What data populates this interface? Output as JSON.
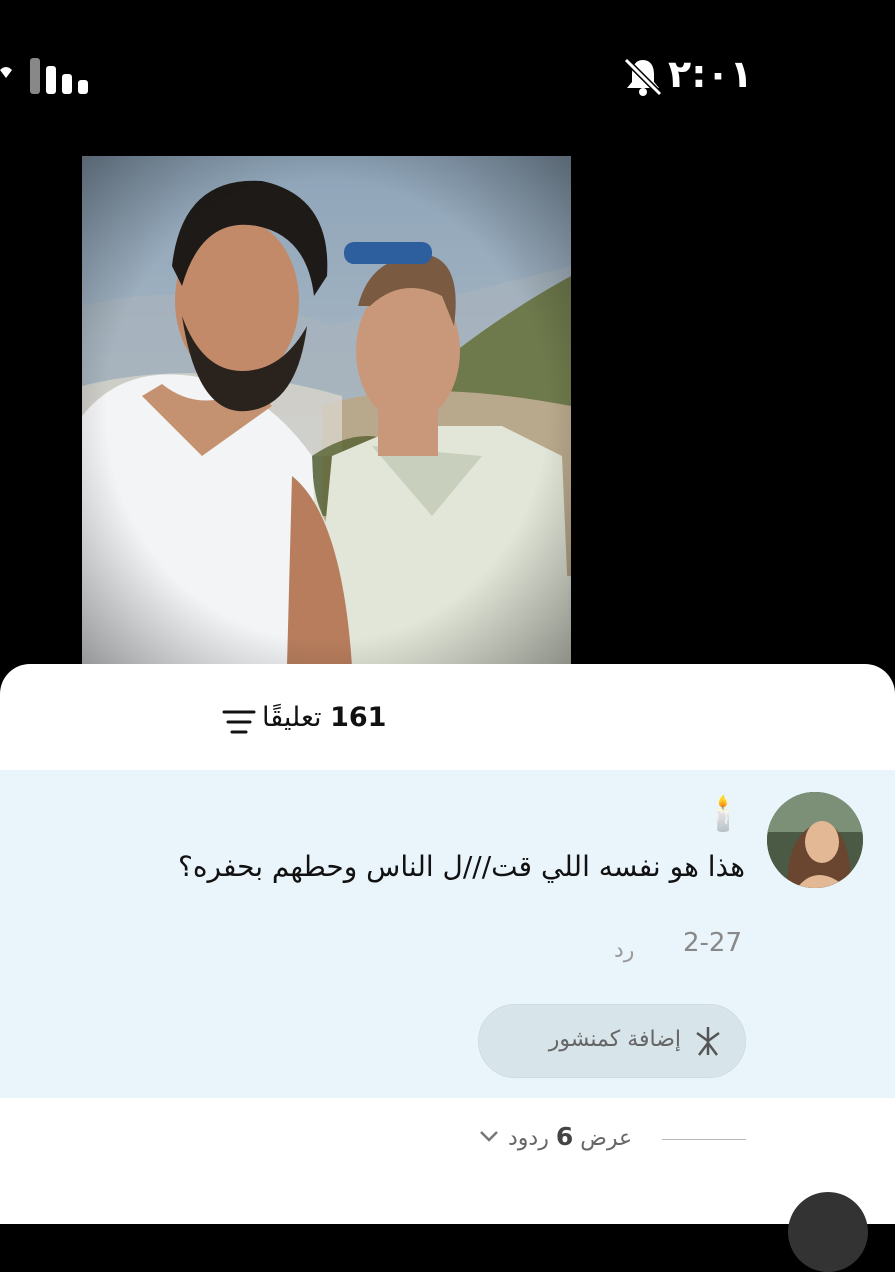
{
  "status_bar": {
    "time": "٢:٠١",
    "icons": [
      "signal-icon",
      "bell-off-icon"
    ]
  },
  "comments": {
    "count": "161",
    "count_label": "تعليقًا",
    "sort_icon": "sort-icon"
  },
  "comment": {
    "emoji": "🕯️",
    "text": "هذا هو نفسه اللي قت///ل الناس وحطهم بحفره؟",
    "date": "2-27",
    "reply_label": "رد",
    "add_post_label": "إضافة كمنشور",
    "view_replies_prefix": "عرض",
    "view_replies_count": "6",
    "view_replies_suffix": "ردود"
  },
  "colors": {
    "card_background": "#e9f5fb",
    "button_background": "#d7e4ea",
    "muted_text": "#888888"
  }
}
